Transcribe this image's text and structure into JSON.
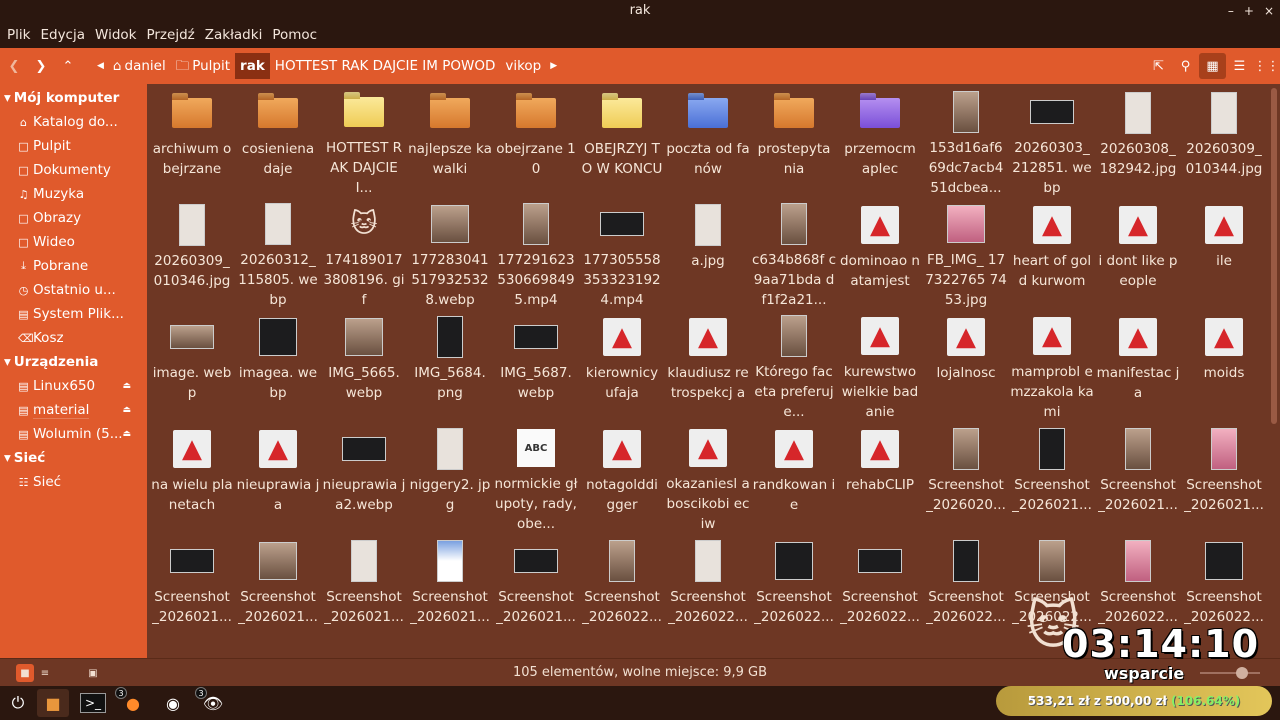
{
  "window": {
    "title": "rak",
    "controls": [
      "–",
      "+",
      "×"
    ]
  },
  "menu": [
    "Plik",
    "Edycja",
    "Widok",
    "Przejdź",
    "Zakładki",
    "Pomoc"
  ],
  "breadcrumbs": [
    {
      "label": "daniel",
      "icon": "home-icon"
    },
    {
      "label": "Pulpit",
      "icon": "folder-icon"
    },
    {
      "label": "rak",
      "active": true
    },
    {
      "label": "HOTTEST RAK DAJCIE IM POWOD"
    },
    {
      "label": "vikop"
    }
  ],
  "sidebar": {
    "computer_label": "Mój komputer",
    "computer_items": [
      {
        "label": "Katalog do...",
        "icon": "home-icon"
      },
      {
        "label": "Pulpit",
        "icon": "desktop-icon"
      },
      {
        "label": "Dokumenty",
        "icon": "documents-icon"
      },
      {
        "label": "Muzyka",
        "icon": "music-icon"
      },
      {
        "label": "Obrazy",
        "icon": "pictures-icon"
      },
      {
        "label": "Wideo",
        "icon": "video-icon"
      },
      {
        "label": "Pobrane",
        "icon": "download-icon"
      },
      {
        "label": "Ostatnio u...",
        "icon": "recent-icon"
      },
      {
        "label": "System Plik...",
        "icon": "filesystem-icon"
      },
      {
        "label": "Kosz",
        "icon": "trash-icon"
      }
    ],
    "devices_label": "Urządzenia",
    "devices": [
      {
        "label": "Linux650"
      },
      {
        "label": "material"
      },
      {
        "label": "Wolumin (5..."
      }
    ],
    "network_label": "Sieć",
    "network_items": [
      {
        "label": "Sieć"
      }
    ]
  },
  "files": [
    {
      "name": "archiwum obejrzane",
      "kind": "folder",
      "color": "orange"
    },
    {
      "name": "cosieniena daje",
      "kind": "folder",
      "color": "orange"
    },
    {
      "name": "HOTTEST RAK DAJCIE I...",
      "kind": "folder",
      "color": "yellow"
    },
    {
      "name": "najlepsze kawalki",
      "kind": "folder",
      "color": "orange"
    },
    {
      "name": "obejrzane 10",
      "kind": "folder",
      "color": "orange"
    },
    {
      "name": "OBEJRZYJ TO W KONCU",
      "kind": "folder",
      "color": "yellow"
    },
    {
      "name": "poczta od fanów",
      "kind": "folder",
      "color": "blue"
    },
    {
      "name": "prostepyta nia",
      "kind": "folder",
      "color": "orange"
    },
    {
      "name": "przemocm aplec",
      "kind": "folder",
      "color": "purple"
    },
    {
      "name": "153d16af6 69dc7acb4 51dcbea...",
      "kind": "image",
      "style": "photo"
    },
    {
      "name": "20260303_ 212851. webp",
      "kind": "image",
      "style": "darkwide"
    },
    {
      "name": "20260308_ 182942.jpg",
      "kind": "image",
      "style": "doc"
    },
    {
      "name": "20260309_ 010344.jpg",
      "kind": "image",
      "style": "doc"
    },
    {
      "name": "20260309_ 010346.jpg",
      "kind": "image",
      "style": "doc"
    },
    {
      "name": "20260312_ 115805. webp",
      "kind": "image",
      "style": "doc"
    },
    {
      "name": "174189017 3808196. gif",
      "kind": "gif"
    },
    {
      "name": "177283041 517932532 8.webp",
      "kind": "image",
      "style": "photosq"
    },
    {
      "name": "177291623 530669849 5.mp4",
      "kind": "image",
      "style": "photo"
    },
    {
      "name": "177305558 353323192 4.mp4",
      "kind": "image",
      "style": "darkwide"
    },
    {
      "name": "a.jpg",
      "kind": "image",
      "style": "doc"
    },
    {
      "name": "c634b868f c9aa71bda df1f2a21...",
      "kind": "image",
      "style": "photo"
    },
    {
      "name": "dominoao natamjest",
      "kind": "video"
    },
    {
      "name": "FB_IMG_ 177322765 7453.jpg",
      "kind": "image",
      "style": "pinksq"
    },
    {
      "name": "heart of gold kurwom",
      "kind": "video"
    },
    {
      "name": "i dont like people",
      "kind": "video"
    },
    {
      "name": "ile",
      "kind": "video"
    },
    {
      "name": "image. webp",
      "kind": "image",
      "style": "photowide"
    },
    {
      "name": "imagea. webp",
      "kind": "image",
      "style": "darksq"
    },
    {
      "name": "IMG_5665. webp",
      "kind": "image",
      "style": "photosq"
    },
    {
      "name": "IMG_5684. png",
      "kind": "image",
      "style": "darkphoto"
    },
    {
      "name": "IMG_5687. webp",
      "kind": "image",
      "style": "darkwide"
    },
    {
      "name": "kierownicy ufaja",
      "kind": "video"
    },
    {
      "name": "klaudiusz retrospekcj a",
      "kind": "video"
    },
    {
      "name": "Którego faceta preferuje...",
      "kind": "image",
      "style": "photo"
    },
    {
      "name": "kurewstwo wielkie badanie",
      "kind": "video"
    },
    {
      "name": "lojalnosc",
      "kind": "video"
    },
    {
      "name": "mamprobl emzzakola kami",
      "kind": "video"
    },
    {
      "name": "manifestac ja",
      "kind": "video"
    },
    {
      "name": "moids",
      "kind": "video"
    },
    {
      "name": "na wielu planetach",
      "kind": "video"
    },
    {
      "name": "nieuprawia ja",
      "kind": "video"
    },
    {
      "name": "nieuprawia ja2.webp",
      "kind": "image",
      "style": "darkwide"
    },
    {
      "name": "niggery2. jpg",
      "kind": "image",
      "style": "doc"
    },
    {
      "name": "normickie głupoty, rady, obe...",
      "kind": "text",
      "glyph": "ABC"
    },
    {
      "name": "notagolddi gger",
      "kind": "video"
    },
    {
      "name": "okazaniesl aboscikobi eciw",
      "kind": "video"
    },
    {
      "name": "randkowan ie",
      "kind": "video"
    },
    {
      "name": "rehabCLIP",
      "kind": "video"
    },
    {
      "name": "Screenshot _2026020...",
      "kind": "image",
      "style": "photo"
    },
    {
      "name": "Screenshot _2026021...",
      "kind": "image",
      "style": "dark"
    },
    {
      "name": "Screenshot _2026021...",
      "kind": "image",
      "style": "photo"
    },
    {
      "name": "Screenshot _2026021...",
      "kind": "image",
      "style": "pink"
    },
    {
      "name": "Screenshot _2026021...",
      "kind": "image",
      "style": "darkwide"
    },
    {
      "name": "Screenshot _2026021...",
      "kind": "image",
      "style": "photosq"
    },
    {
      "name": "Screenshot _2026021...",
      "kind": "image",
      "style": "doc"
    },
    {
      "name": "Screenshot _2026021...",
      "kind": "image",
      "style": "blue"
    },
    {
      "name": "Screenshot _2026021...",
      "kind": "image",
      "style": "darkwide"
    },
    {
      "name": "Screenshot _2026022...",
      "kind": "image",
      "style": "photo"
    },
    {
      "name": "Screenshot _2026022...",
      "kind": "image",
      "style": "doc"
    },
    {
      "name": "Screenshot _2026022...",
      "kind": "image",
      "style": "darksq"
    },
    {
      "name": "Screenshot _2026022...",
      "kind": "image",
      "style": "darkwide"
    },
    {
      "name": "Screenshot _2026022...",
      "kind": "image",
      "style": "dark"
    },
    {
      "name": "Screenshot _2026022...",
      "kind": "image",
      "style": "photo"
    },
    {
      "name": "Screenshot _2026022...",
      "kind": "image",
      "style": "pink"
    },
    {
      "name": "Screenshot _2026022...",
      "kind": "image",
      "style": "darksq"
    }
  ],
  "status": {
    "text": "105 elementów, wolne miejsce: 9,9 GB"
  },
  "taskbar": {
    "badges": [
      "3",
      "3"
    ]
  },
  "overlay": {
    "clock": "03:14:10",
    "label": "wsparcie",
    "donation": "533,21 zł z 500,00 zł",
    "donation_pct": "(106.64%)"
  },
  "colors": {
    "accent": "#e05a2c",
    "background": "#6e3724",
    "titlebar": "#2b170f"
  }
}
